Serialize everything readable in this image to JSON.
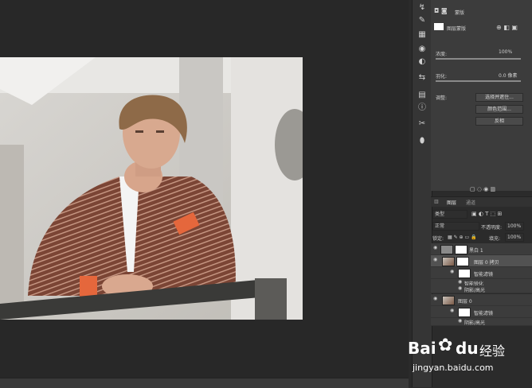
{
  "properties": {
    "header_icons": "◘ ◙",
    "mask_label": "蒙版",
    "layer_mask_label": "图层蒙版",
    "density_label": "浓度:",
    "density_value": "100%",
    "feather_label": "羽化:",
    "feather_value": "0.0 像素",
    "refine_label": "调整:",
    "btn_select_mask": "选择并遮住...",
    "btn_color_range": "颜色范围...",
    "btn_invert": "反相"
  },
  "layers_panel": {
    "tabs": [
      "图层",
      "通道"
    ],
    "filter_label": "类型",
    "blend_mode": "正常",
    "opacity_label": "不透明度:",
    "opacity_value": "100%",
    "lock_label": "锁定:",
    "fill_label": "填充:",
    "fill_value": "100%",
    "layers": [
      {
        "name": "黑白 1",
        "kind": "adjustment"
      },
      {
        "name": "图层 0 拷贝",
        "kind": "smart"
      },
      {
        "name": "智能滤镜",
        "kind": "filter"
      },
      {
        "name": "智能锐化",
        "kind": "effect"
      },
      {
        "name": "阴影/高光",
        "kind": "effect"
      },
      {
        "name": "图层 0",
        "kind": "smart"
      },
      {
        "name": "智能滤镜",
        "kind": "filter"
      },
      {
        "name": "阴影/高光",
        "kind": "effect"
      }
    ]
  },
  "watermark": {
    "brand": "Bai",
    "brand2": "du",
    "cn": "经验",
    "url": "jingyan.baidu.com"
  }
}
